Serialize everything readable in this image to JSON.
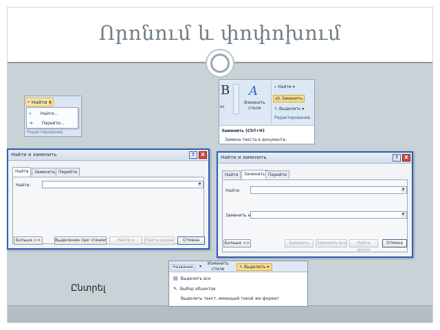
{
  "slide": {
    "title": "Որոնում և փոփոխում",
    "caption": "Ընտրել"
  },
  "find_menu": {
    "button_label": "Найти",
    "items": [
      "Найти...",
      "Перейти..."
    ],
    "group_label": "Редактирование"
  },
  "ribbon": {
    "big_letter": "B",
    "side_fragment": "кс",
    "styles_label_1": "Изменить",
    "styles_label_2": "стили",
    "find_label": "Найти",
    "replace_label": "Заменить",
    "select_label": "Выделить",
    "group_label": "Редактирование",
    "tooltip_title": "Заменить (Ctrl+H)",
    "tooltip_body": "Замена текста в документе."
  },
  "dialog_find": {
    "title": "Найти и заменить",
    "help": "?",
    "close": "X",
    "tabs": [
      "Найти",
      "Заменить",
      "Перейти"
    ],
    "find_label": "Найти:",
    "find_value": "",
    "buttons": {
      "more": "Больше >>",
      "highlight": "Выделение при чтении",
      "find_in": "Найти в",
      "find_next": "Найти далее",
      "cancel": "Отмена"
    }
  },
  "dialog_replace": {
    "title": "Найти и заменить",
    "help": "?",
    "close": "X",
    "tabs": [
      "Найти",
      "Заменить",
      "Перейти"
    ],
    "find_label": "Найти:",
    "find_value": "",
    "replace_label": "Заменить на:",
    "replace_value": "",
    "buttons": {
      "more": "Больше >>",
      "replace": "Заменить",
      "replace_all": "Заменить все",
      "find_next": "Найти далее",
      "cancel": "Отмена"
    }
  },
  "select_menu": {
    "ribbon_left": "Название",
    "ribbon_styles_1": "Изменить",
    "ribbon_styles_2": "стили",
    "select_button": "Выделить",
    "items": [
      "Выделить все",
      "Выбор объектов",
      "Выделить текст, имеющий такой же формат"
    ]
  },
  "colors": {
    "slide_title": "#6f7e88",
    "content_bg": "#c9d2d6",
    "dialog_border": "#2a5fb8",
    "close_button": "#cf4b3c"
  }
}
